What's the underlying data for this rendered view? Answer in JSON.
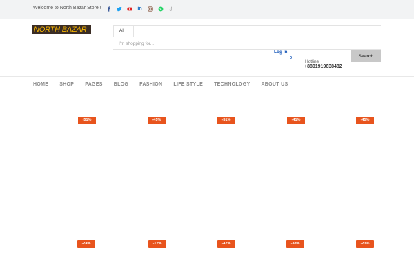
{
  "topbar": {
    "welcome": "Welcome to North Bazar Store !",
    "social": [
      "facebook-icon",
      "twitter-icon",
      "youtube-icon",
      "linkedin-icon",
      "instagram-icon",
      "whatsapp-icon",
      "tiktok-icon"
    ],
    "social_labels": {
      "linkedin": "in"
    }
  },
  "header": {
    "logo": "NORTH BAZAR",
    "category": "All",
    "search_placeholder": "I'm shopping for...",
    "login": "Log In",
    "cart_count": "0",
    "hotline_label": "Hotline",
    "hotline_number": "+8801919638482",
    "search_button": "Search"
  },
  "nav": [
    "HOME",
    "SHOP",
    "PAGES",
    "BLOG",
    "FASHION",
    "LIFE STYLE",
    "TECHNOLOGY",
    "ABOUT US"
  ],
  "products": {
    "row1": [
      "-51%",
      "-45%",
      "-51%",
      "-41%",
      "-45%"
    ],
    "row2": [
      "-24%",
      "-12%",
      "-47%",
      "-38%",
      "-23%"
    ]
  },
  "colors": {
    "accent": "#e8541d",
    "link": "#1556b8",
    "logo_bg": "#3a2c24",
    "logo_text": "#f5b400"
  }
}
